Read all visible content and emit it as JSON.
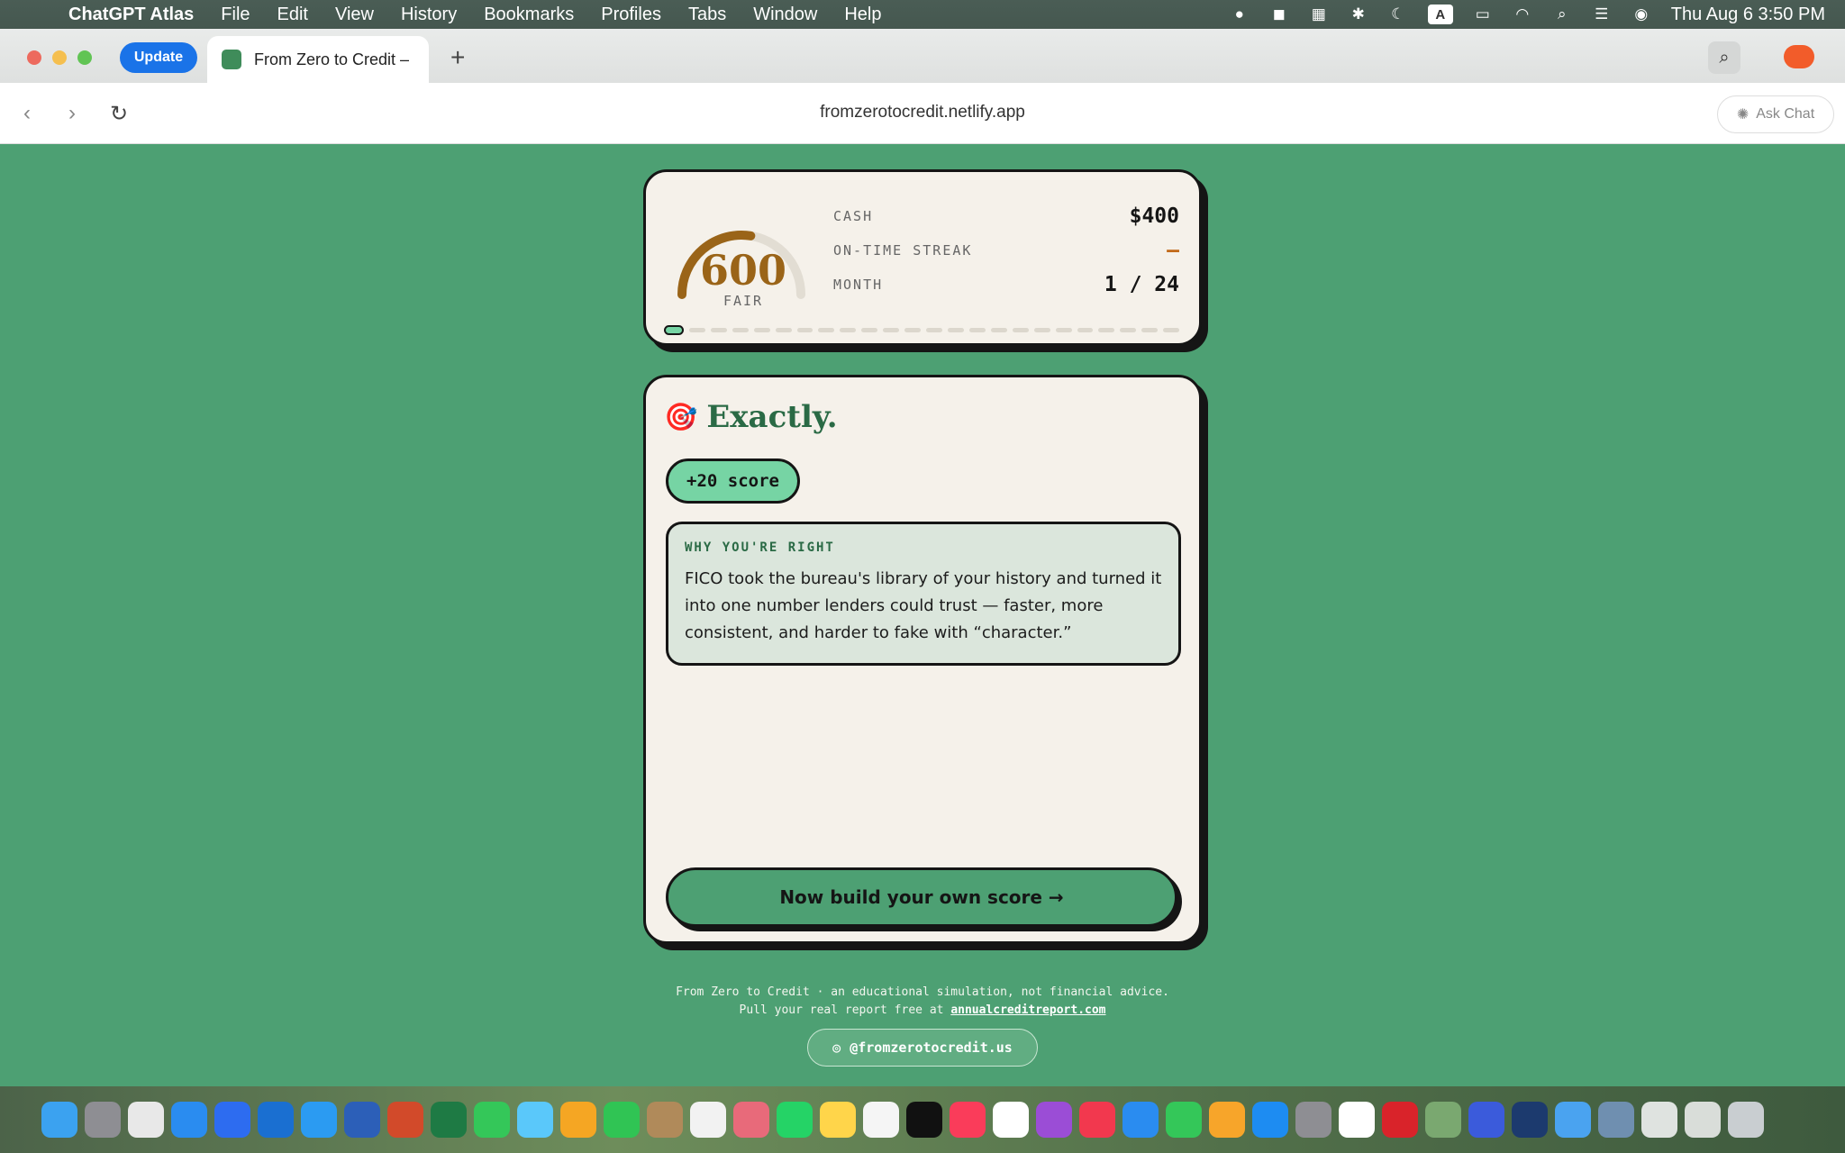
{
  "menubar": {
    "app": "ChatGPT Atlas",
    "items": [
      "File",
      "Edit",
      "View",
      "History",
      "Bookmarks",
      "Profiles",
      "Tabs",
      "Window",
      "Help"
    ],
    "datetime": "Thu Aug 6  3:50 PM"
  },
  "browser": {
    "update_label": "Update",
    "tab_title": "From Zero to Credit –",
    "url": "fromzerotocredit.netlify.app",
    "ask_chat": "Ask Chat"
  },
  "status": {
    "score": "600",
    "rating": "FAIR",
    "gauge_fraction": 0.55,
    "cash_label": "CASH",
    "cash_value": "$400",
    "streak_label": "ON-TIME STREAK",
    "streak_value": "–",
    "month_label": "MONTH",
    "month_value": "1 / 24",
    "month_current": 1,
    "month_total": 24
  },
  "result": {
    "emoji": "🎯",
    "title": "Exactly.",
    "score_delta": "+20 score",
    "explain_label": "WHY YOU'RE RIGHT",
    "explain_body": "FICO took the bureau's library of your history and turned it into one number lenders could trust — faster, more consistent, and harder to fake with “character.”",
    "cta": "Now build your own score →"
  },
  "footer": {
    "line1": "From Zero to Credit · an educational simulation, not financial advice.",
    "line2_prefix": "Pull your real report free at ",
    "line2_link": "annualcreditreport.com",
    "instagram": "@fromzerotocredit.us"
  },
  "colors": {
    "page_bg": "#4da073",
    "card_bg": "#f5f1ea",
    "accent_gold": "#9a6418",
    "accent_green": "#76d4a4",
    "title_green": "#2a6a45"
  }
}
